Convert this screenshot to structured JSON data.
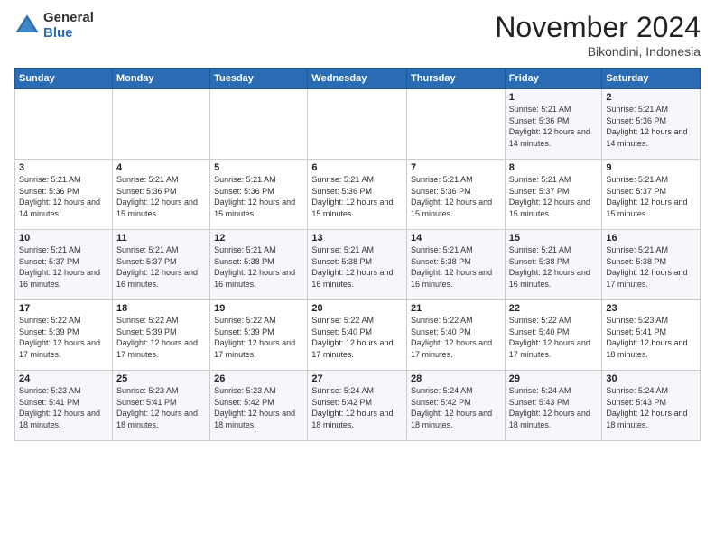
{
  "logo": {
    "general": "General",
    "blue": "Blue"
  },
  "title": "November 2024",
  "subtitle": "Bikondini, Indonesia",
  "days_of_week": [
    "Sunday",
    "Monday",
    "Tuesday",
    "Wednesday",
    "Thursday",
    "Friday",
    "Saturday"
  ],
  "weeks": [
    [
      {
        "day": "",
        "info": ""
      },
      {
        "day": "",
        "info": ""
      },
      {
        "day": "",
        "info": ""
      },
      {
        "day": "",
        "info": ""
      },
      {
        "day": "",
        "info": ""
      },
      {
        "day": "1",
        "info": "Sunrise: 5:21 AM\nSunset: 5:36 PM\nDaylight: 12 hours and 14 minutes."
      },
      {
        "day": "2",
        "info": "Sunrise: 5:21 AM\nSunset: 5:36 PM\nDaylight: 12 hours and 14 minutes."
      }
    ],
    [
      {
        "day": "3",
        "info": "Sunrise: 5:21 AM\nSunset: 5:36 PM\nDaylight: 12 hours and 14 minutes."
      },
      {
        "day": "4",
        "info": "Sunrise: 5:21 AM\nSunset: 5:36 PM\nDaylight: 12 hours and 15 minutes."
      },
      {
        "day": "5",
        "info": "Sunrise: 5:21 AM\nSunset: 5:36 PM\nDaylight: 12 hours and 15 minutes."
      },
      {
        "day": "6",
        "info": "Sunrise: 5:21 AM\nSunset: 5:36 PM\nDaylight: 12 hours and 15 minutes."
      },
      {
        "day": "7",
        "info": "Sunrise: 5:21 AM\nSunset: 5:36 PM\nDaylight: 12 hours and 15 minutes."
      },
      {
        "day": "8",
        "info": "Sunrise: 5:21 AM\nSunset: 5:37 PM\nDaylight: 12 hours and 15 minutes."
      },
      {
        "day": "9",
        "info": "Sunrise: 5:21 AM\nSunset: 5:37 PM\nDaylight: 12 hours and 15 minutes."
      }
    ],
    [
      {
        "day": "10",
        "info": "Sunrise: 5:21 AM\nSunset: 5:37 PM\nDaylight: 12 hours and 16 minutes."
      },
      {
        "day": "11",
        "info": "Sunrise: 5:21 AM\nSunset: 5:37 PM\nDaylight: 12 hours and 16 minutes."
      },
      {
        "day": "12",
        "info": "Sunrise: 5:21 AM\nSunset: 5:38 PM\nDaylight: 12 hours and 16 minutes."
      },
      {
        "day": "13",
        "info": "Sunrise: 5:21 AM\nSunset: 5:38 PM\nDaylight: 12 hours and 16 minutes."
      },
      {
        "day": "14",
        "info": "Sunrise: 5:21 AM\nSunset: 5:38 PM\nDaylight: 12 hours and 16 minutes."
      },
      {
        "day": "15",
        "info": "Sunrise: 5:21 AM\nSunset: 5:38 PM\nDaylight: 12 hours and 16 minutes."
      },
      {
        "day": "16",
        "info": "Sunrise: 5:21 AM\nSunset: 5:38 PM\nDaylight: 12 hours and 17 minutes."
      }
    ],
    [
      {
        "day": "17",
        "info": "Sunrise: 5:22 AM\nSunset: 5:39 PM\nDaylight: 12 hours and 17 minutes."
      },
      {
        "day": "18",
        "info": "Sunrise: 5:22 AM\nSunset: 5:39 PM\nDaylight: 12 hours and 17 minutes."
      },
      {
        "day": "19",
        "info": "Sunrise: 5:22 AM\nSunset: 5:39 PM\nDaylight: 12 hours and 17 minutes."
      },
      {
        "day": "20",
        "info": "Sunrise: 5:22 AM\nSunset: 5:40 PM\nDaylight: 12 hours and 17 minutes."
      },
      {
        "day": "21",
        "info": "Sunrise: 5:22 AM\nSunset: 5:40 PM\nDaylight: 12 hours and 17 minutes."
      },
      {
        "day": "22",
        "info": "Sunrise: 5:22 AM\nSunset: 5:40 PM\nDaylight: 12 hours and 17 minutes."
      },
      {
        "day": "23",
        "info": "Sunrise: 5:23 AM\nSunset: 5:41 PM\nDaylight: 12 hours and 18 minutes."
      }
    ],
    [
      {
        "day": "24",
        "info": "Sunrise: 5:23 AM\nSunset: 5:41 PM\nDaylight: 12 hours and 18 minutes."
      },
      {
        "day": "25",
        "info": "Sunrise: 5:23 AM\nSunset: 5:41 PM\nDaylight: 12 hours and 18 minutes."
      },
      {
        "day": "26",
        "info": "Sunrise: 5:23 AM\nSunset: 5:42 PM\nDaylight: 12 hours and 18 minutes."
      },
      {
        "day": "27",
        "info": "Sunrise: 5:24 AM\nSunset: 5:42 PM\nDaylight: 12 hours and 18 minutes."
      },
      {
        "day": "28",
        "info": "Sunrise: 5:24 AM\nSunset: 5:42 PM\nDaylight: 12 hours and 18 minutes."
      },
      {
        "day": "29",
        "info": "Sunrise: 5:24 AM\nSunset: 5:43 PM\nDaylight: 12 hours and 18 minutes."
      },
      {
        "day": "30",
        "info": "Sunrise: 5:24 AM\nSunset: 5:43 PM\nDaylight: 12 hours and 18 minutes."
      }
    ]
  ]
}
